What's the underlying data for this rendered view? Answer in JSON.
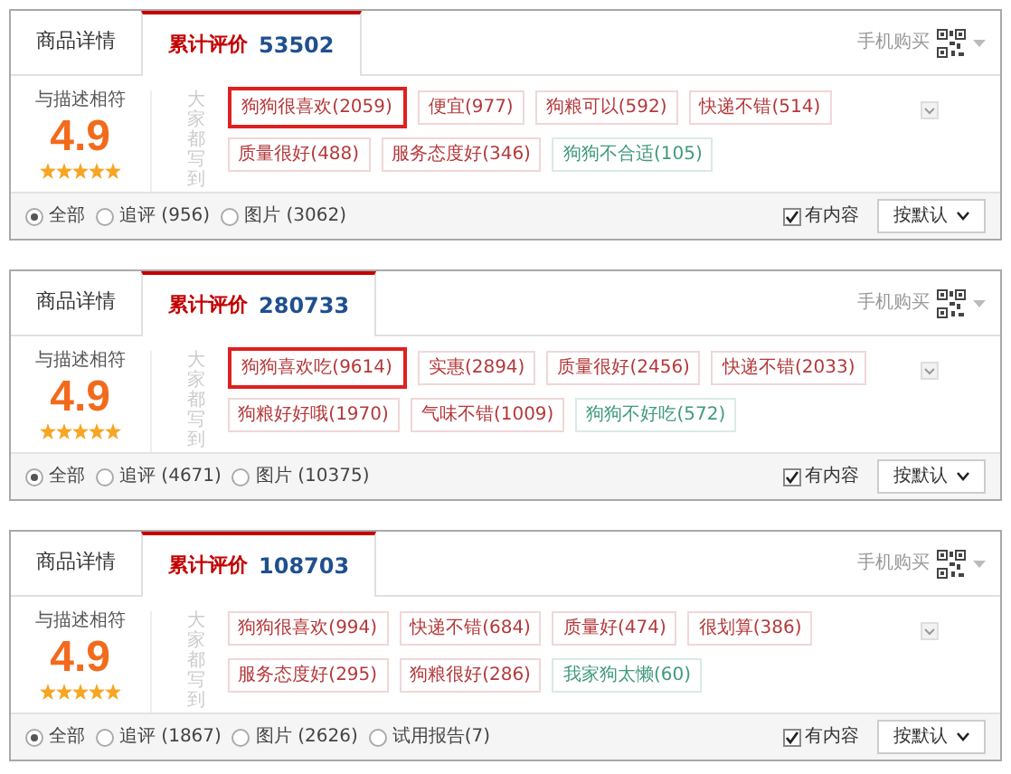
{
  "panels": [
    {
      "tabs": [
        {
          "label": "商品详情",
          "selected": false
        },
        {
          "label": "累计评价",
          "count": "53502",
          "selected": true
        }
      ],
      "mobile_buy": "手机购买",
      "score_label": "与描述相符",
      "score": "4.9",
      "stars": 5,
      "tags_heading": "大家都写到",
      "tags": [
        {
          "label": "狗狗很喜欢(2059)",
          "color": "#b5383a",
          "selected": true
        },
        {
          "label": "便宜(977)",
          "color": "#b5383a",
          "selected": false
        },
        {
          "label": "狗粮可以(592)",
          "color": "#b5383a",
          "selected": false
        },
        {
          "label": "快递不错(514)",
          "color": "#b5383a",
          "selected": false
        },
        {
          "label": "质量很好(488)",
          "color": "#b5383a",
          "selected": false
        },
        {
          "label": "服务态度好(346)",
          "color": "#b5383a",
          "selected": false
        },
        {
          "label": "狗狗不合适(105)",
          "color": "#3f9a7c",
          "selected": false
        }
      ],
      "filters": [
        {
          "label": "全部",
          "selected": true
        },
        {
          "label": "追评 (956)",
          "selected": false
        },
        {
          "label": "图片 (3062)",
          "selected": false
        }
      ],
      "has_content": {
        "label": "有内容",
        "checked": true
      },
      "sort": "按默认"
    },
    {
      "tabs": [
        {
          "label": "商品详情",
          "selected": false
        },
        {
          "label": "累计评价",
          "count": "280733",
          "selected": true
        }
      ],
      "mobile_buy": "手机购买",
      "score_label": "与描述相符",
      "score": "4.9",
      "stars": 5,
      "tags_heading": "大家都写到",
      "tags": [
        {
          "label": "狗狗喜欢吃(9614)",
          "color": "#b5383a",
          "selected": true
        },
        {
          "label": "实惠(2894)",
          "color": "#b5383a",
          "selected": false
        },
        {
          "label": "质量很好(2456)",
          "color": "#b5383a",
          "selected": false
        },
        {
          "label": "快递不错(2033)",
          "color": "#b5383a",
          "selected": false
        },
        {
          "label": "狗粮好好哦(1970)",
          "color": "#b5383a",
          "selected": false
        },
        {
          "label": "气味不错(1009)",
          "color": "#b5383a",
          "selected": false
        },
        {
          "label": "狗狗不好吃(572)",
          "color": "#3f9a7c",
          "selected": false
        }
      ],
      "filters": [
        {
          "label": "全部",
          "selected": true
        },
        {
          "label": "追评 (4671)",
          "selected": false
        },
        {
          "label": "图片 (10375)",
          "selected": false
        }
      ],
      "has_content": {
        "label": "有内容",
        "checked": true
      },
      "sort": "按默认"
    },
    {
      "tabs": [
        {
          "label": "商品详情",
          "selected": false
        },
        {
          "label": "累计评价",
          "count": "108703",
          "selected": true
        }
      ],
      "mobile_buy": "手机购买",
      "score_label": "与描述相符",
      "score": "4.9",
      "stars": 5,
      "tags_heading": "大家都写到",
      "tags": [
        {
          "label": "狗狗很喜欢(994)",
          "color": "#b5383a",
          "selected": false
        },
        {
          "label": "快递不错(684)",
          "color": "#b5383a",
          "selected": false
        },
        {
          "label": "质量好(474)",
          "color": "#b5383a",
          "selected": false
        },
        {
          "label": "很划算(386)",
          "color": "#b5383a",
          "selected": false
        },
        {
          "label": "服务态度好(295)",
          "color": "#b5383a",
          "selected": false
        },
        {
          "label": "狗粮很好(286)",
          "color": "#b5383a",
          "selected": false
        },
        {
          "label": "我家狗太懒(60)",
          "color": "#3f9a7c",
          "selected": false
        }
      ],
      "filters": [
        {
          "label": "全部",
          "selected": true
        },
        {
          "label": "追评 (1867)",
          "selected": false
        },
        {
          "label": "图片 (2626)",
          "selected": false
        },
        {
          "label": "试用报告(7)",
          "selected": false
        }
      ],
      "has_content": {
        "label": "有内容",
        "checked": true
      },
      "sort": "按默认"
    }
  ]
}
